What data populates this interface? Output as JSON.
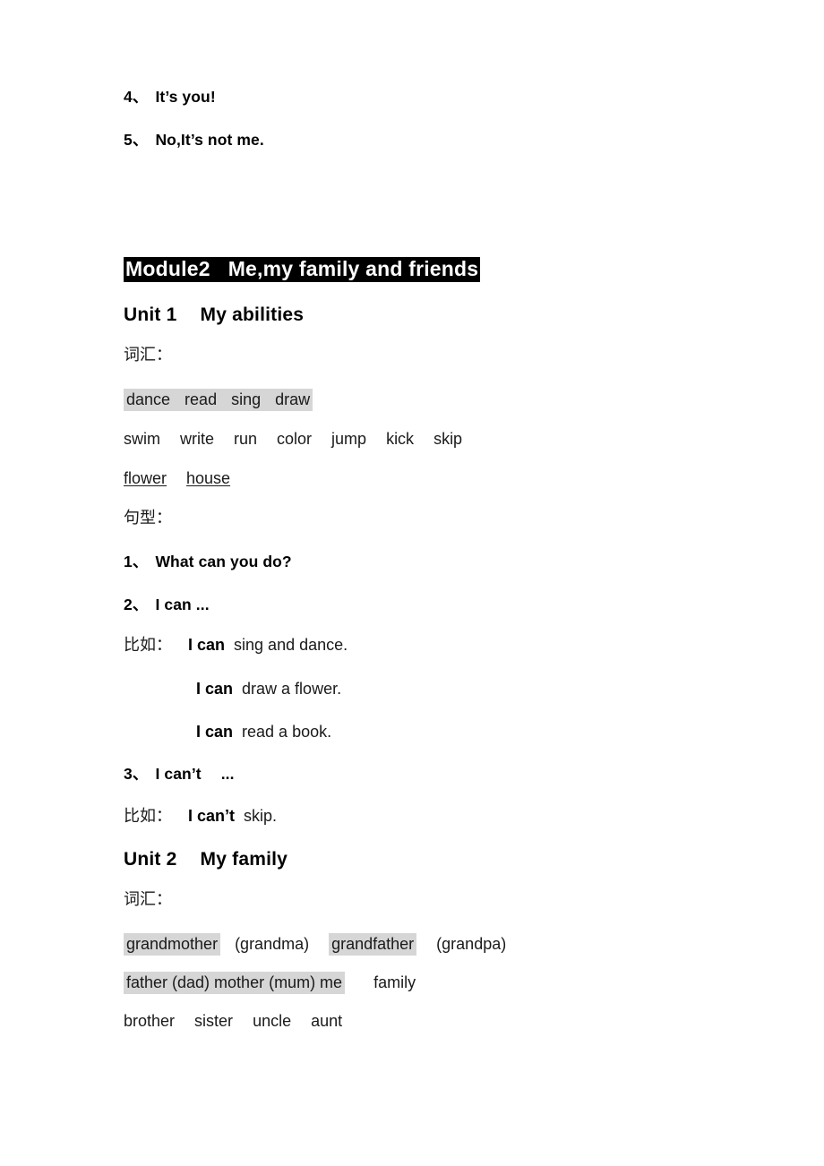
{
  "document": {
    "top_items": [
      {
        "num": "4、",
        "text": "It’s you!"
      },
      {
        "num": "5、",
        "text": "No,It’s not me."
      }
    ],
    "module_header": {
      "part1": "Module2",
      "part2": "Me,my family and friends"
    },
    "unit1": {
      "label": "Unit 1",
      "title": "My abilities",
      "vocab_label": "词汇：",
      "vocab_rows": [
        {
          "highlight": true,
          "words": [
            "dance",
            "read",
            "sing",
            "draw"
          ]
        },
        {
          "highlight": false,
          "words": [
            "swim",
            "write",
            "run",
            "color",
            "jump",
            "kick",
            "skip"
          ]
        },
        {
          "underline": true,
          "words": [
            "flower",
            "house"
          ]
        }
      ],
      "pattern_label": "句型：",
      "patterns": [
        {
          "num": "1、",
          "text": "What can you do?"
        },
        {
          "num": "2、",
          "text": "I can ..."
        }
      ],
      "examples_label_1": "比如：",
      "examples_1": [
        {
          "lead": "I can",
          "rest": "sing and dance."
        },
        {
          "lead": "I can",
          "rest": "draw a flower."
        },
        {
          "lead": "I can",
          "rest": "read a book."
        }
      ],
      "pattern3": {
        "num": "3、",
        "text": "I can’t",
        "ellipsis": "..."
      },
      "examples_label_2": "比如：",
      "examples_2": [
        {
          "lead": "I can’t",
          "rest": "skip."
        }
      ]
    },
    "unit2": {
      "label": "Unit 2",
      "title": "My family",
      "vocab_label": "词汇：",
      "family_row1": {
        "grandmother": "grandmother",
        "grandma": "(grandma)",
        "grandfather": "grandfather",
        "grandpa": "(grandpa)"
      },
      "family_row2": {
        "highlighted": "father (dad)   mother (mum)    me",
        "plain": "family"
      },
      "family_row3": [
        "brother",
        "sister",
        "uncle",
        "aunt"
      ]
    }
  },
  "colors": {
    "highlight_gray": "#d6d6d6",
    "highlight_black": "#000000",
    "text": "#000000"
  }
}
